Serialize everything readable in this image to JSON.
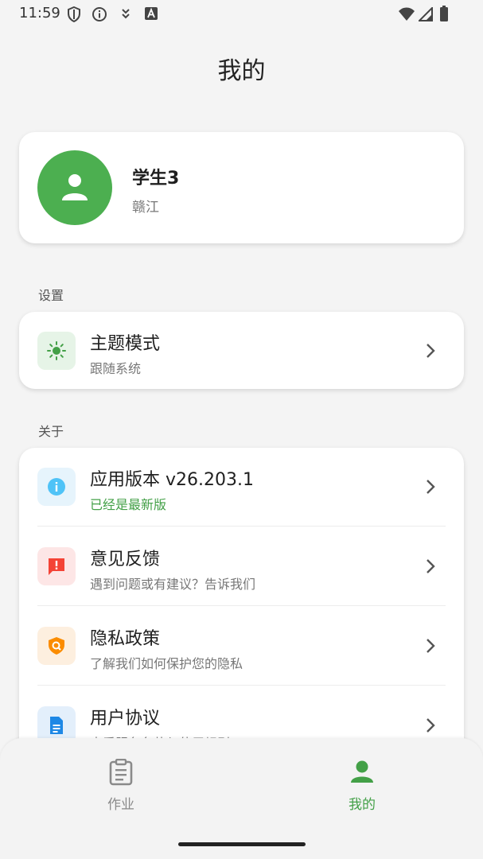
{
  "status_bar": {
    "time": "11:59",
    "left_icons": [
      "shield-icon",
      "info-icon",
      "download-icon",
      "keyboard-a-icon"
    ],
    "right_icons": [
      "wifi-icon",
      "signal-icon",
      "battery-icon"
    ]
  },
  "header": {
    "title": "我的"
  },
  "profile": {
    "name": "学生3",
    "location": "赣江",
    "avatar_icon": "person-icon"
  },
  "settings": {
    "section_label": "设置",
    "items": [
      {
        "title": "主题模式",
        "subtitle": "跟随系统",
        "icon": "sun-icon",
        "icon_color": "#43a047",
        "icon_bg": "#e6f4e7"
      }
    ]
  },
  "about": {
    "section_label": "关于",
    "items": [
      {
        "title": "应用版本 v26.203.1",
        "subtitle": "已经是最新版",
        "icon": "info-icon",
        "icon_color": "#4fc3f7",
        "icon_bg": "#e6f4fc"
      },
      {
        "title": "意见反馈",
        "subtitle": "遇到问题或有建议？告诉我们",
        "icon": "feedback-icon",
        "icon_color": "#f44336",
        "icon_bg": "#fde6e6"
      },
      {
        "title": "隐私政策",
        "subtitle": "了解我们如何保护您的隐私",
        "icon": "privacy-shield-icon",
        "icon_color": "#fb8c00",
        "icon_bg": "#fdefdf"
      },
      {
        "title": "用户协议",
        "subtitle": "查看服务条款与使用规则",
        "icon": "document-icon",
        "icon_color": "#1e88e5",
        "icon_bg": "#e3effb"
      }
    ]
  },
  "bottom_nav": {
    "items": [
      {
        "label": "作业",
        "icon": "assignment-icon",
        "active": false
      },
      {
        "label": "我的",
        "icon": "person-icon",
        "active": true
      }
    ]
  },
  "colors": {
    "accent": "#43a047",
    "inactive": "#8a8a8a"
  }
}
